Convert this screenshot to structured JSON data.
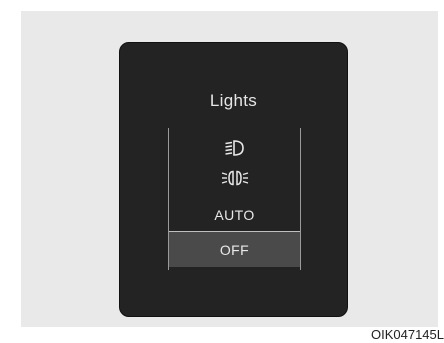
{
  "panel": {
    "title": "Lights",
    "options": [
      {
        "icon": "headlight-icon"
      },
      {
        "icon": "parking-light-icon"
      },
      {
        "label": "AUTO"
      },
      {
        "label": "OFF",
        "selected": true
      }
    ]
  },
  "caption": "OIK047145L",
  "colors": {
    "display_bg": "#232323",
    "selected_bg": "#4a4a4a",
    "text": "#e8e8e8",
    "page_bg": "#e9e9e9"
  }
}
